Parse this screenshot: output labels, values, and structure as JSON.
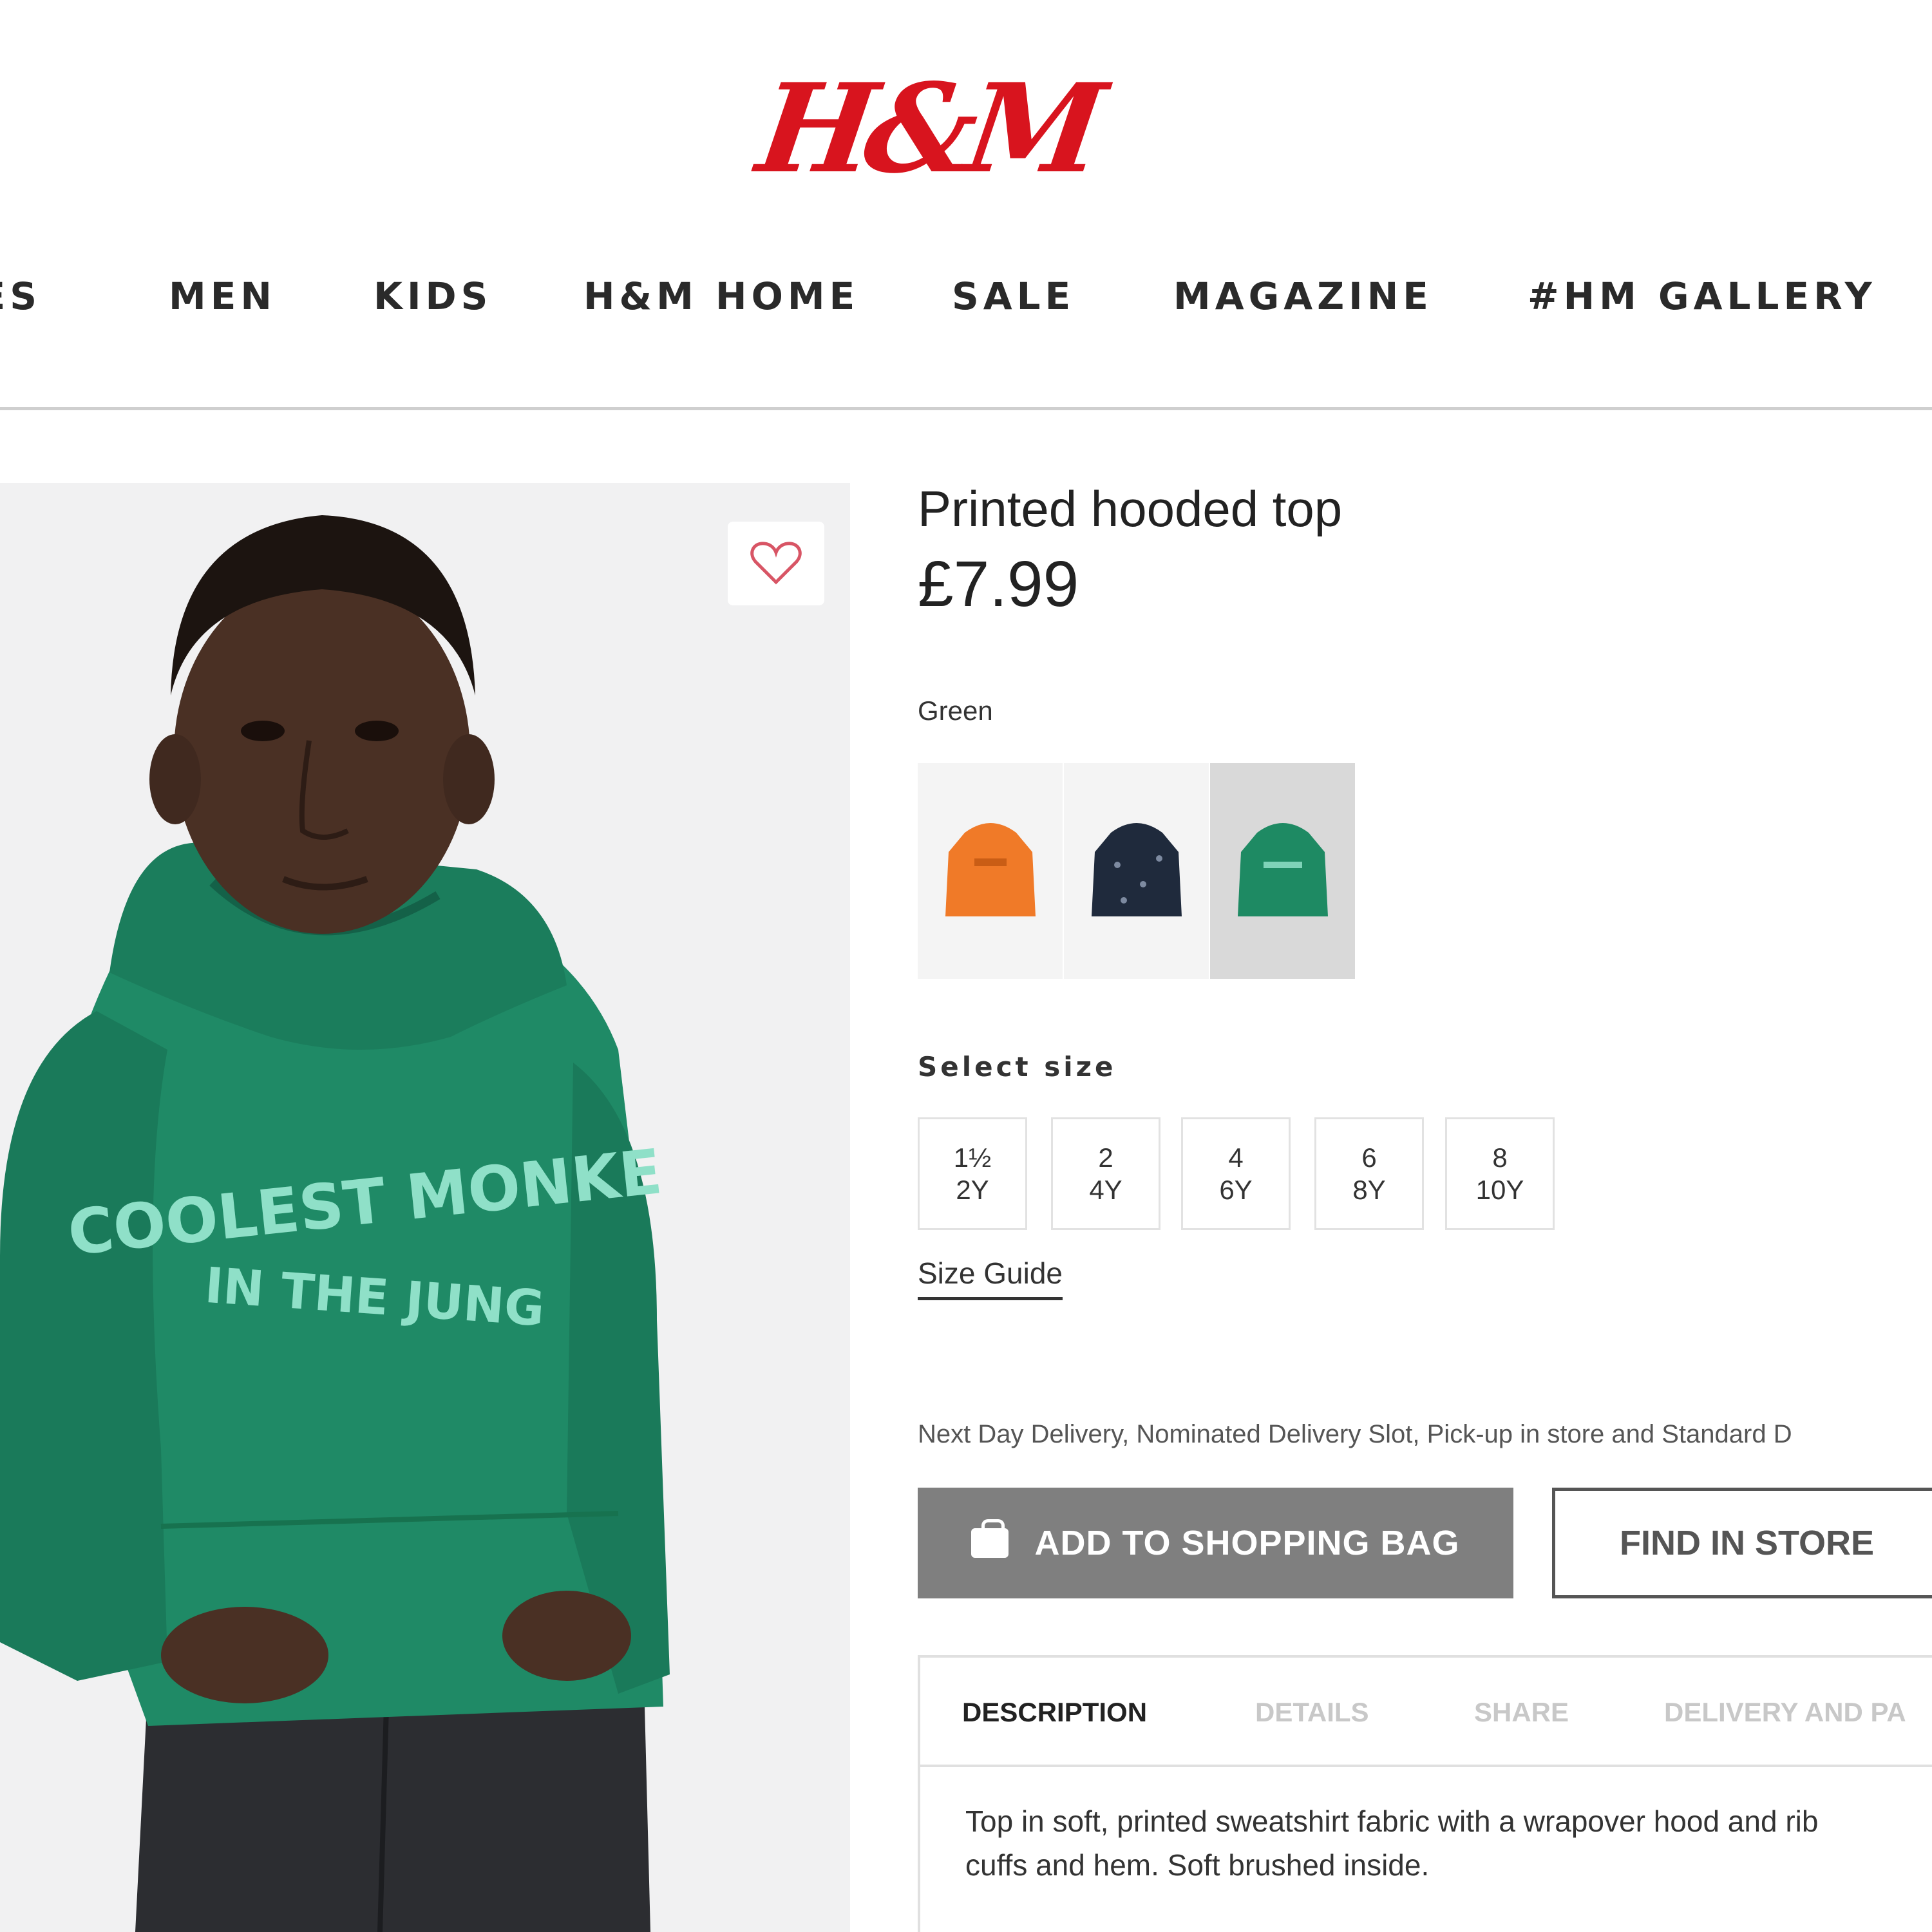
{
  "brand": {
    "logo_text": "H&M",
    "logo_color": "#d8141e"
  },
  "nav": {
    "items": [
      "IES",
      "MEN",
      "KIDS",
      "H&M HOME",
      "SALE",
      "MAGAZINE",
      "#HM GALLERY"
    ]
  },
  "image": {
    "print_line_1": "COOLEST MONKE",
    "print_line_2": "IN THE JUNG"
  },
  "product": {
    "title": "Printed hooded top",
    "price": "£7.99",
    "color_label": "Green",
    "swatches": [
      {
        "name": "orange",
        "color": "#f07a28",
        "selected": false
      },
      {
        "name": "navy",
        "color": "#1f2a3c",
        "selected": false
      },
      {
        "name": "green",
        "color": "#1e8a63",
        "selected": true
      }
    ],
    "size_label": "Select size",
    "sizes": [
      {
        "line1": "1½",
        "line2": "2Y"
      },
      {
        "line1": "2",
        "line2": "4Y"
      },
      {
        "line1": "4",
        "line2": "6Y"
      },
      {
        "line1": "6",
        "line2": "8Y"
      },
      {
        "line1": "8",
        "line2": "10Y"
      }
    ],
    "size_guide": "Size Guide",
    "delivery_text": "Next Day Delivery, Nominated Delivery Slot, Pick-up in store and Standard D",
    "add_to_bag": "ADD TO SHOPPING BAG",
    "find_in_store": "FIND IN STORE"
  },
  "tabs": {
    "items": [
      "DESCRIPTION",
      "DETAILS",
      "SHARE",
      "DELIVERY AND PA"
    ],
    "active_index": 0,
    "description_line_1": "Top in soft, printed sweatshirt fabric with a wrapover hood and rib",
    "description_line_2": "cuffs and hem. Soft brushed inside."
  },
  "colors": {
    "hoodie_green": "#1f8a66",
    "print_mint": "#8fe0c8",
    "skin": "#4a3024",
    "hair": "#1c1410",
    "jeans": "#2c2d31",
    "heart": "#d85565"
  }
}
